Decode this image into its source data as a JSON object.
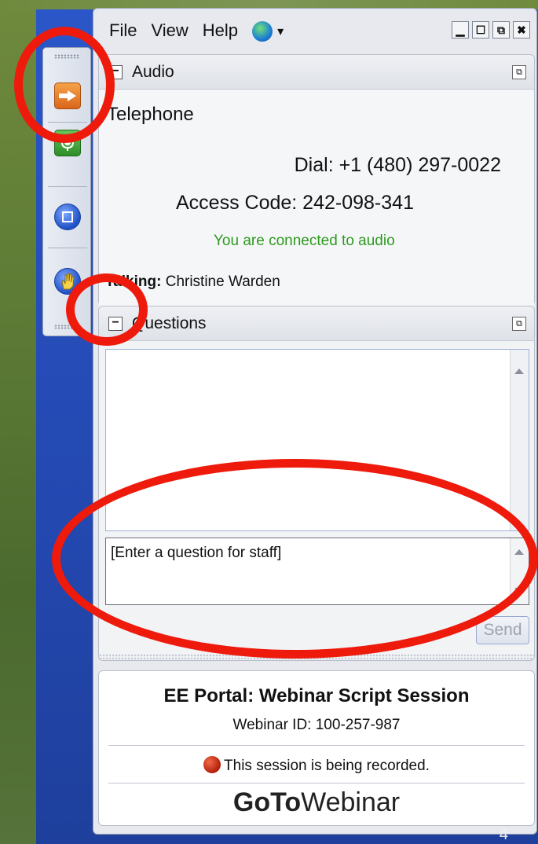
{
  "menu": {
    "file": "File",
    "view": "View",
    "help": "Help",
    "globe_icon": "globe-icon",
    "globe_caret": "▾"
  },
  "window_controls": {
    "minimize": "▁",
    "restore": "☐",
    "popout": "⧉",
    "close": "✖"
  },
  "toolstrip": {
    "icons": [
      "show-hide-arrow-icon",
      "microphone-icon",
      "screen-icon",
      "raise-hand-icon"
    ]
  },
  "audio": {
    "title": "Audio",
    "mode": "Telephone",
    "dial": "Dial: +1 (480) 297-0022",
    "access_code": "Access Code: 242-098-341",
    "status": "You are connected to audio",
    "talking_label": "Talking:",
    "talking_name": "Christine Warden"
  },
  "questions": {
    "title": "Questions",
    "input_placeholder": "[Enter a question for staff]",
    "send_label": "Send"
  },
  "session": {
    "title": "EE Portal: Webinar Script Session",
    "webinar_id": "Webinar ID: 100-257-987",
    "recorded": "This session is being recorded.",
    "logo_bold": "GoTo",
    "logo_rest": "Webinar"
  },
  "page_number": "4",
  "colors": {
    "annotation": "#ee1a0c",
    "connected_green": "#2e9a1f",
    "desktop_blue": "#2a56c9"
  }
}
